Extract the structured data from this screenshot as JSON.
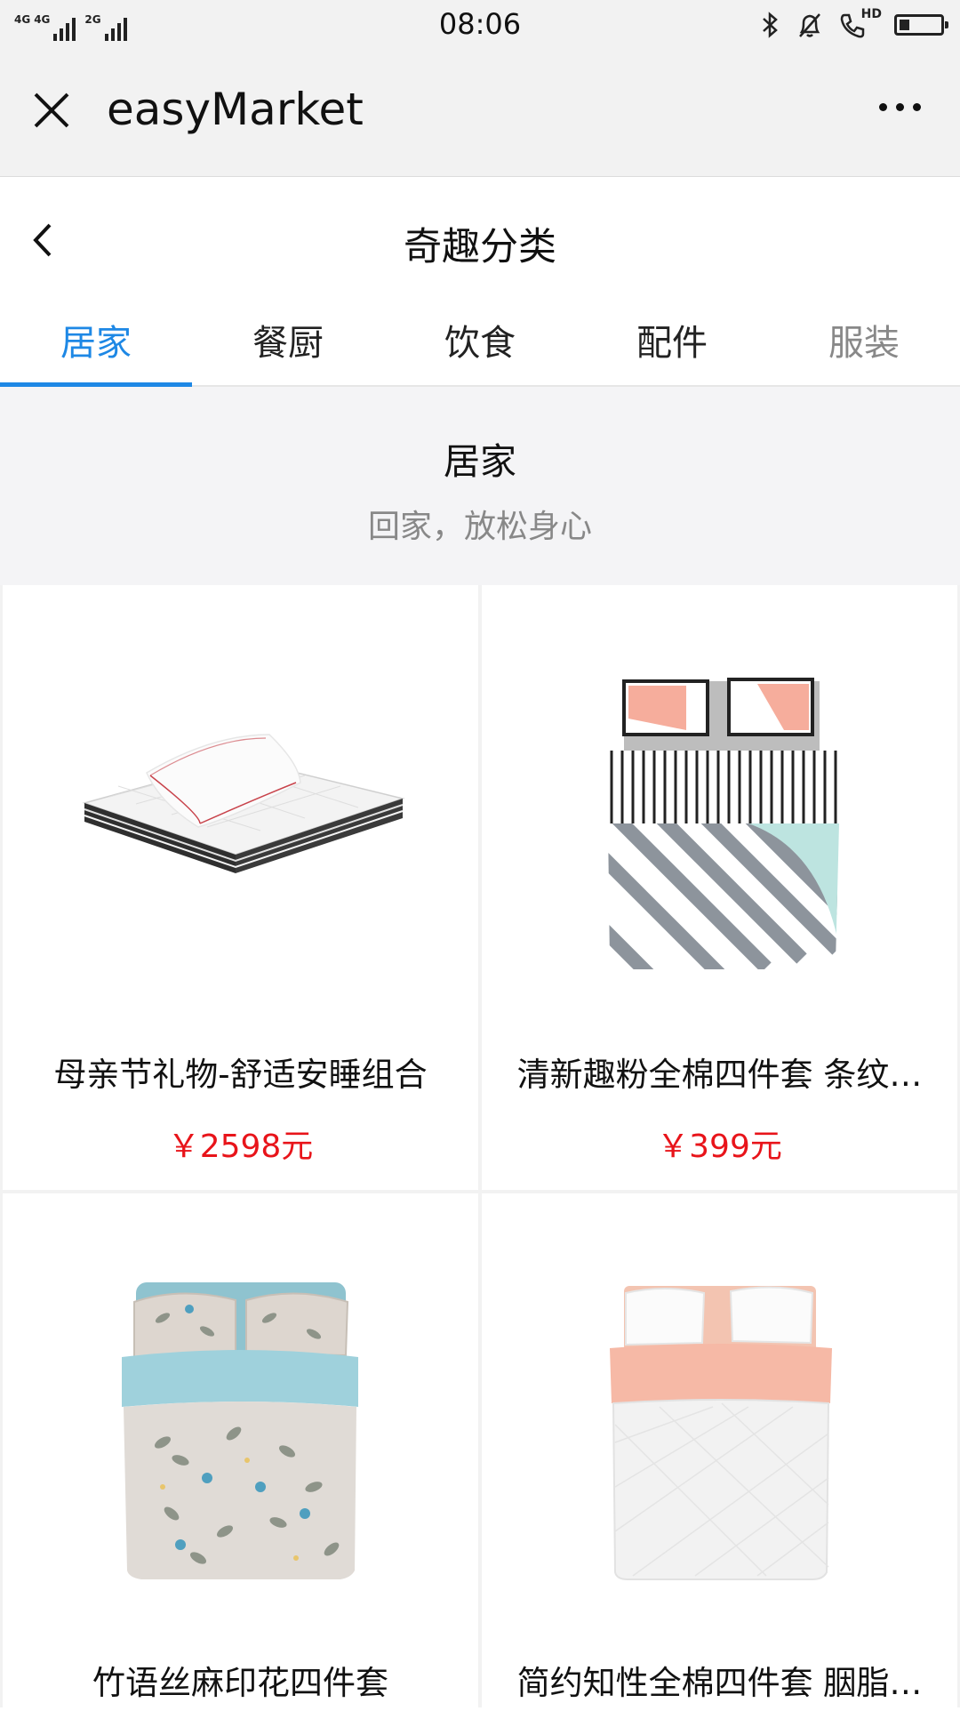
{
  "status_bar": {
    "network_1": "4G",
    "network_2": "4G",
    "network_3": "2G",
    "time": "08:06",
    "call_badge": "HD",
    "battery_level": 0.25
  },
  "app_header": {
    "title": "easyMarket"
  },
  "page": {
    "title": "奇趣分类"
  },
  "tabs": [
    {
      "label": "居家",
      "active": true
    },
    {
      "label": "餐厨",
      "active": false
    },
    {
      "label": "饮食",
      "active": false
    },
    {
      "label": "配件",
      "active": false
    },
    {
      "label": "服装",
      "active": false
    }
  ],
  "category": {
    "name": "居家",
    "description": "回家，放松身心"
  },
  "products": [
    {
      "name": "母亲节礼物-舒适安睡组合",
      "price": "￥2598元"
    },
    {
      "name": "清新趣粉全棉四件套 条纹…",
      "price": "￥399元"
    },
    {
      "name": "竹语丝麻印花四件套",
      "price": ""
    },
    {
      "name": "简约知性全棉四件套 胭脂…",
      "price": ""
    }
  ],
  "colors": {
    "accent": "#1e88e5",
    "price": "#e8141a",
    "header_bg": "#f2f2f2"
  }
}
